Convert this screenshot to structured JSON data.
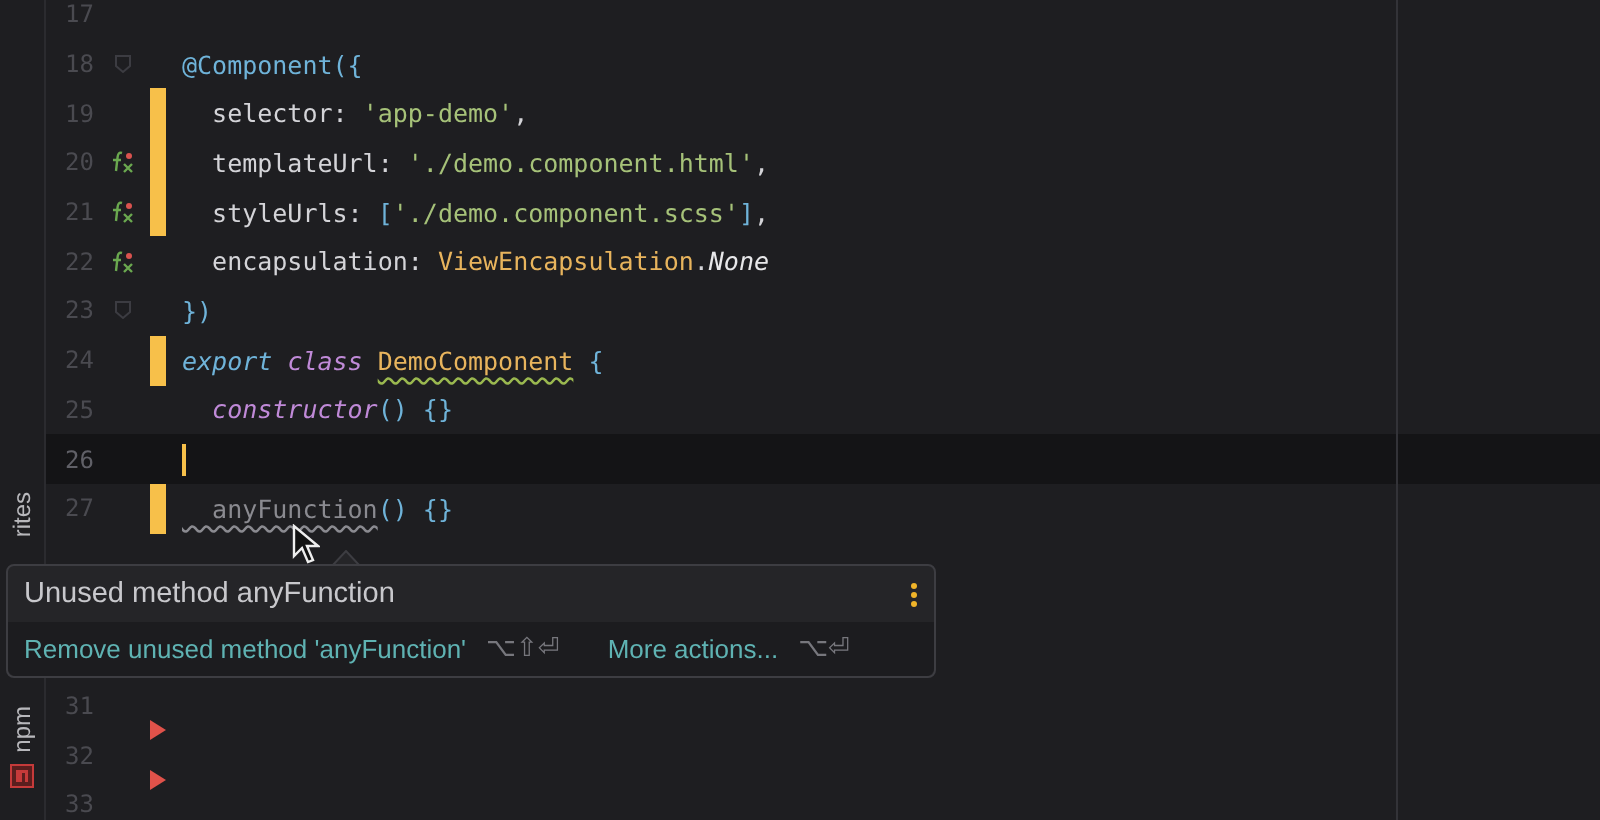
{
  "tool_strip": [
    {
      "label": "rites",
      "kind": "label"
    },
    {
      "label": "npm",
      "kind": "npm"
    }
  ],
  "lines": [
    {
      "number": "17",
      "modified": false,
      "current": false,
      "caret": false
    },
    {
      "number": "18",
      "gutter_icon": {
        "kind": "fold"
      },
      "modified": false,
      "current": false,
      "caret": false,
      "tokens": [
        {
          "text": "@Component",
          "kind": "decorator"
        },
        {
          "text": "({",
          "kind": "punct"
        }
      ]
    },
    {
      "number": "19",
      "modified": true,
      "current": false,
      "caret": false,
      "tokens": [
        {
          "text": "  selector: ",
          "kind": "plain"
        },
        {
          "text": "'app-demo'",
          "kind": "string"
        },
        {
          "text": ",",
          "kind": "plain"
        }
      ]
    },
    {
      "number": "20",
      "gutter_icon": {
        "kind": "fx"
      },
      "modified": true,
      "current": false,
      "caret": false,
      "tokens": [
        {
          "text": "  templateUrl: ",
          "kind": "plain"
        },
        {
          "text": "'./demo.component.html'",
          "kind": "string"
        },
        {
          "text": ",",
          "kind": "plain"
        }
      ]
    },
    {
      "number": "21",
      "gutter_icon": {
        "kind": "fx"
      },
      "modified": true,
      "current": false,
      "caret": false,
      "tokens": [
        {
          "text": "  styleUrls: ",
          "kind": "plain"
        },
        {
          "text": "[",
          "kind": "punct"
        },
        {
          "text": "'./demo.component.scss'",
          "kind": "string"
        },
        {
          "text": "]",
          "kind": "punct"
        },
        {
          "text": ",",
          "kind": "plain"
        }
      ]
    },
    {
      "number": "22",
      "gutter_icon": {
        "kind": "fx"
      },
      "modified": false,
      "current": false,
      "caret": false,
      "tokens": [
        {
          "text": "  encapsulation: ",
          "kind": "plain"
        },
        {
          "text": "ViewEncapsulation",
          "kind": "class"
        },
        {
          "text": ".",
          "kind": "plain"
        },
        {
          "text": "None",
          "kind": "italic"
        }
      ]
    },
    {
      "number": "23",
      "gutter_icon": {
        "kind": "fold"
      },
      "modified": false,
      "current": false,
      "caret": false,
      "tokens": [
        {
          "text": "})",
          "kind": "punct"
        }
      ]
    },
    {
      "number": "24",
      "modified": true,
      "current": false,
      "caret": false,
      "tokens": [
        {
          "text": "export ",
          "kind": "keyword"
        },
        {
          "text": "class ",
          "kind": "storage"
        },
        {
          "text": "DemoComponent",
          "kind": "class_warn"
        },
        {
          "text": " {",
          "kind": "punct"
        }
      ]
    },
    {
      "number": "25",
      "modified": false,
      "current": false,
      "caret": false,
      "tokens": [
        {
          "text": "  constructor",
          "kind": "storage"
        },
        {
          "text": "() {}",
          "kind": "punct"
        }
      ]
    },
    {
      "number": "26",
      "modified": false,
      "current": true,
      "caret": true
    },
    {
      "number": "27",
      "modified": true,
      "current": false,
      "caret": false,
      "tokens": [
        {
          "text": "  anyFunction",
          "kind": "unused"
        },
        {
          "text": "() {}",
          "kind": "punct"
        }
      ]
    }
  ],
  "lines_after": [
    {
      "number": "31",
      "deleted_below": true
    },
    {
      "number": "32",
      "deleted_below": true
    },
    {
      "number": "33",
      "deleted_below": false
    }
  ],
  "popup": {
    "title": "Unused method anyFunction",
    "actions": [
      {
        "label": "Remove unused method 'anyFunction'",
        "shortcut": "⌥⇧⏎"
      },
      {
        "label": "More actions...",
        "shortcut": "⌥⏎"
      }
    ]
  }
}
